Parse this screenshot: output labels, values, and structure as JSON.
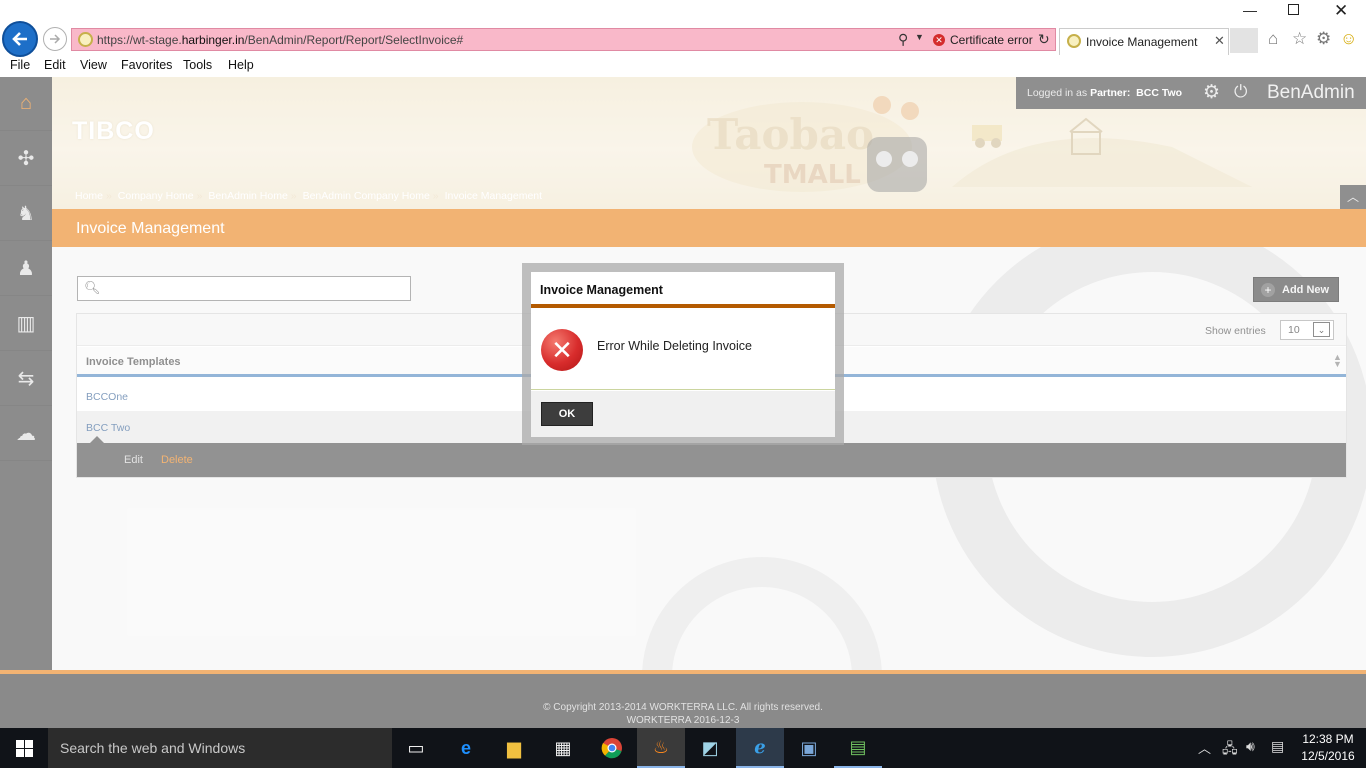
{
  "browser": {
    "url_prefix": "https://wt-stage.",
    "url_host": "harbinger.in",
    "url_path": "/BenAdmin/Report/Report/SelectInvoice#",
    "cert_error": "Certificate error",
    "tab_title": "Invoice Management",
    "menu": [
      "File",
      "Edit",
      "View",
      "Favorites",
      "Tools",
      "Help"
    ]
  },
  "header": {
    "logo": "TIBCO",
    "logged_in_prefix": "Logged in as ",
    "partner_label": "Partner:",
    "partner_name": "BCC Two",
    "brand": "BenAdmin",
    "breadcrumb": [
      "Home",
      "Company Home",
      "BenAdmin Home",
      "BenAdmin Company Home",
      "Invoice Management"
    ]
  },
  "page": {
    "title": "Invoice Management",
    "add_new": "Add New",
    "show_entries_label": "Show entries",
    "entries_value": "10",
    "table_header": "Invoice Templates",
    "rows": [
      "BCCOne",
      "BCC Two"
    ],
    "row_actions": {
      "edit": "Edit",
      "delete": "Delete"
    }
  },
  "modal": {
    "title": "Invoice Management",
    "message": "Error While Deleting Invoice",
    "ok": "OK"
  },
  "footer": {
    "copyright": "© Copyright 2013-2014 WORKTERRA LLC. All rights reserved.",
    "version": "WORKTERRA 2016-12-3"
  },
  "taskbar": {
    "search_placeholder": "Search the web and Windows",
    "time": "12:38 PM",
    "date": "12/5/2016"
  },
  "colors": {
    "accent_orange": "#e87600",
    "nav_dark": "#2f2f2f",
    "link_blue": "#1d4e89",
    "error_red": "#d82c2c",
    "address_error_pink": "#f9b8c9"
  },
  "icons": {
    "left_nav": [
      "home-icon",
      "puzzle-icon",
      "user-star-icon",
      "user-icon",
      "bar-chart-icon",
      "transfer-icon",
      "chat-icon"
    ]
  }
}
